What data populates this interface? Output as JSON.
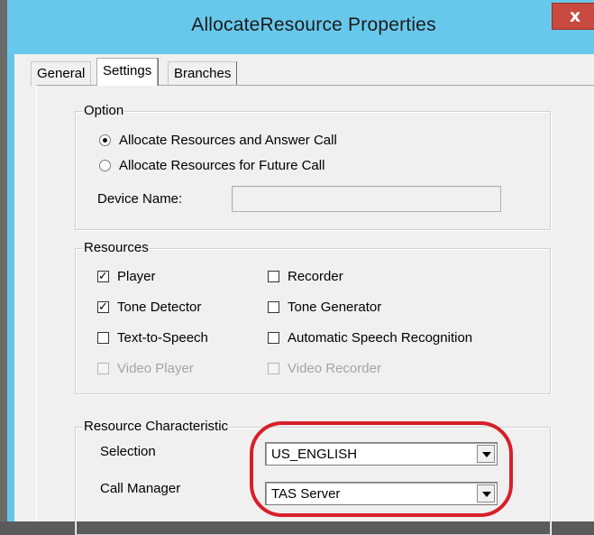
{
  "window": {
    "title": "AllocateResource Properties",
    "close_glyph": "x"
  },
  "tabs": [
    {
      "label": "General",
      "active": false
    },
    {
      "label": "Settings",
      "active": true
    },
    {
      "label": "Branches",
      "active": false
    }
  ],
  "option_group": {
    "legend": "Option",
    "radios": [
      {
        "label": "Allocate Resources and Answer Call",
        "selected": true
      },
      {
        "label": "Allocate Resources for Future Call",
        "selected": false
      }
    ],
    "device_name_label": "Device Name:",
    "device_name_value": ""
  },
  "resources_group": {
    "legend": "Resources",
    "checkboxes": [
      {
        "label": "Player",
        "checked": true,
        "enabled": true
      },
      {
        "label": "Recorder",
        "checked": false,
        "enabled": true
      },
      {
        "label": "Tone Detector",
        "checked": true,
        "enabled": true
      },
      {
        "label": "Tone Generator",
        "checked": false,
        "enabled": true
      },
      {
        "label": "Text-to-Speech",
        "checked": false,
        "enabled": true
      },
      {
        "label": "Automatic Speech Recognition",
        "checked": false,
        "enabled": true
      },
      {
        "label": "Video Player",
        "checked": false,
        "enabled": false
      },
      {
        "label": "Video Recorder",
        "checked": false,
        "enabled": false
      }
    ]
  },
  "characteristic_group": {
    "legend": "Resource Characteristic",
    "selection_label": "Selection",
    "selection_value": "US_ENGLISH",
    "call_manager_label": "Call Manager",
    "call_manager_value": "TAS Server"
  },
  "check_glyph": "✓",
  "colors": {
    "titlebar": "#68c8ec",
    "close_button": "#c94a40",
    "highlight_ring": "#d71f2a"
  }
}
